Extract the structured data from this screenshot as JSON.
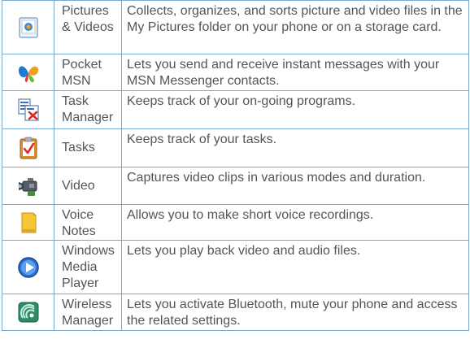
{
  "rows": [
    {
      "icon": "pictures-icon",
      "name": "Pictures & Videos",
      "description": "Collects, organizes, and sorts picture and video files in the My Pictures folder on your phone or on a storage card."
    },
    {
      "icon": "msn-butterfly-icon",
      "name": "Pocket MSN",
      "description": "Lets you send and receive instant messages with your MSN Messenger contacts."
    },
    {
      "icon": "task-manager-icon",
      "name": "Task Manager",
      "description": "Keeps track of your on-going programs."
    },
    {
      "icon": "tasks-clipboard-icon",
      "name": "Tasks",
      "description": "Keeps track of your tasks."
    },
    {
      "icon": "video-camera-icon",
      "name": "Video",
      "description": "Captures video clips in various modes and duration."
    },
    {
      "icon": "voice-notes-icon",
      "name": "Voice Notes",
      "description": "Allows you to make short voice recordings."
    },
    {
      "icon": "media-player-icon",
      "name": "Windows Media Player",
      "description": "Lets you play back video and audio files."
    },
    {
      "icon": "wireless-icon",
      "name": "Wireless Manager",
      "description": "Lets you activate Bluetooth, mute your phone and access the related settings."
    }
  ]
}
